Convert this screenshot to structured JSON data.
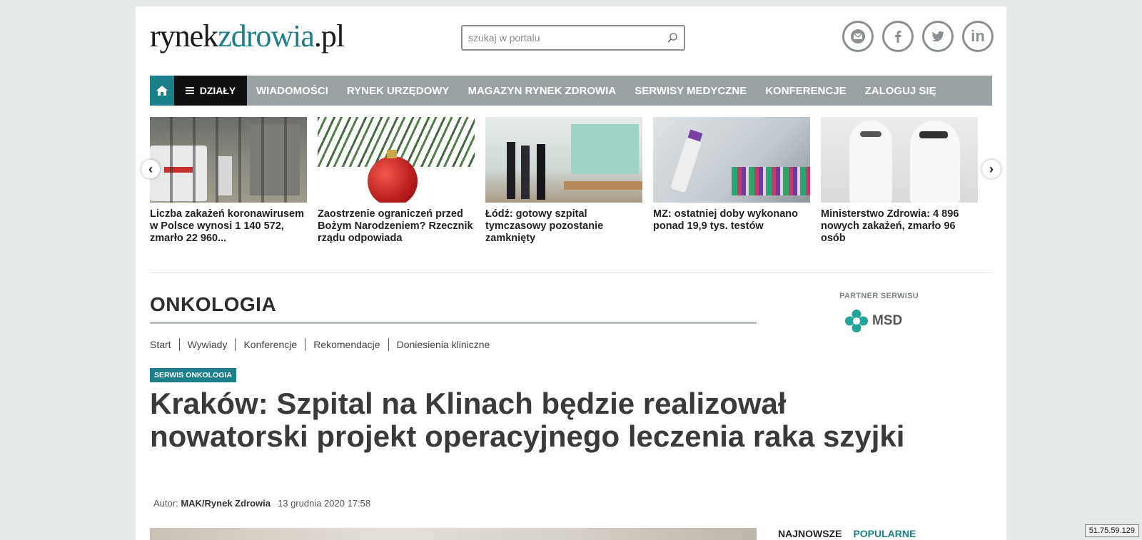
{
  "logo": {
    "part1": "rynek",
    "part2": "zdrowia",
    "part3": ".pl"
  },
  "search": {
    "placeholder": "szukaj w portalu"
  },
  "social": [
    {
      "icon": "mail-icon"
    },
    {
      "icon": "facebook-icon"
    },
    {
      "icon": "twitter-icon"
    },
    {
      "icon": "linkedin-icon",
      "text": "in"
    }
  ],
  "nav": {
    "dzialy": "DZIAŁY",
    "items": [
      "WIADOMOŚCI",
      "RYNEK URZĘDOWY",
      "MAGAZYN RYNEK ZDROWIA",
      "SERWISY MEDYCZNE",
      "KONFERENCJE",
      "ZALOGUJ SIĘ"
    ]
  },
  "carousel": [
    {
      "title": "Liczba zakażeń koronawirusem w Polsce wynosi 1 140 572, zmarło 22 960..."
    },
    {
      "title": "Zaostrzenie ograniczeń przed Bożym Narodzeniem? Rzecznik rządu odpowiada"
    },
    {
      "title": "Łódź: gotowy szpital tymczasowy pozostanie zamknięty"
    },
    {
      "title": "MZ: ostatniej doby wykonano ponad 19,9 tys. testów"
    },
    {
      "title": "Ministerstwo Zdrowia: 4 896 nowych zakażeń, zmarło 96 osób"
    }
  ],
  "section": {
    "title": "ONKOLOGIA",
    "subnav": [
      "Start",
      "Wywiady",
      "Konferencje",
      "Rekomendacje",
      "Doniesienia kliniczne"
    ]
  },
  "partner": {
    "label": "PARTNER SERWISU",
    "name": "MSD"
  },
  "article": {
    "badge": "SERWIS ONKOLOGIA",
    "headline": "Kraków: Szpital na Klinach będzie realizował nowatorski projekt operacyjnego leczenia raka szyjki",
    "author_label": "Autor:",
    "author": "MAK/Rynek Zdrowia",
    "date": "13 grudnia 2020 17:58"
  },
  "tabs": {
    "newest": "NAJNOWSZE",
    "popular": "POPULARNE"
  },
  "ip": "51.75.59.129",
  "colors": {
    "teal": "#1b7f8c",
    "nav_gray": "#9aa1a5",
    "dark": "#111111"
  }
}
